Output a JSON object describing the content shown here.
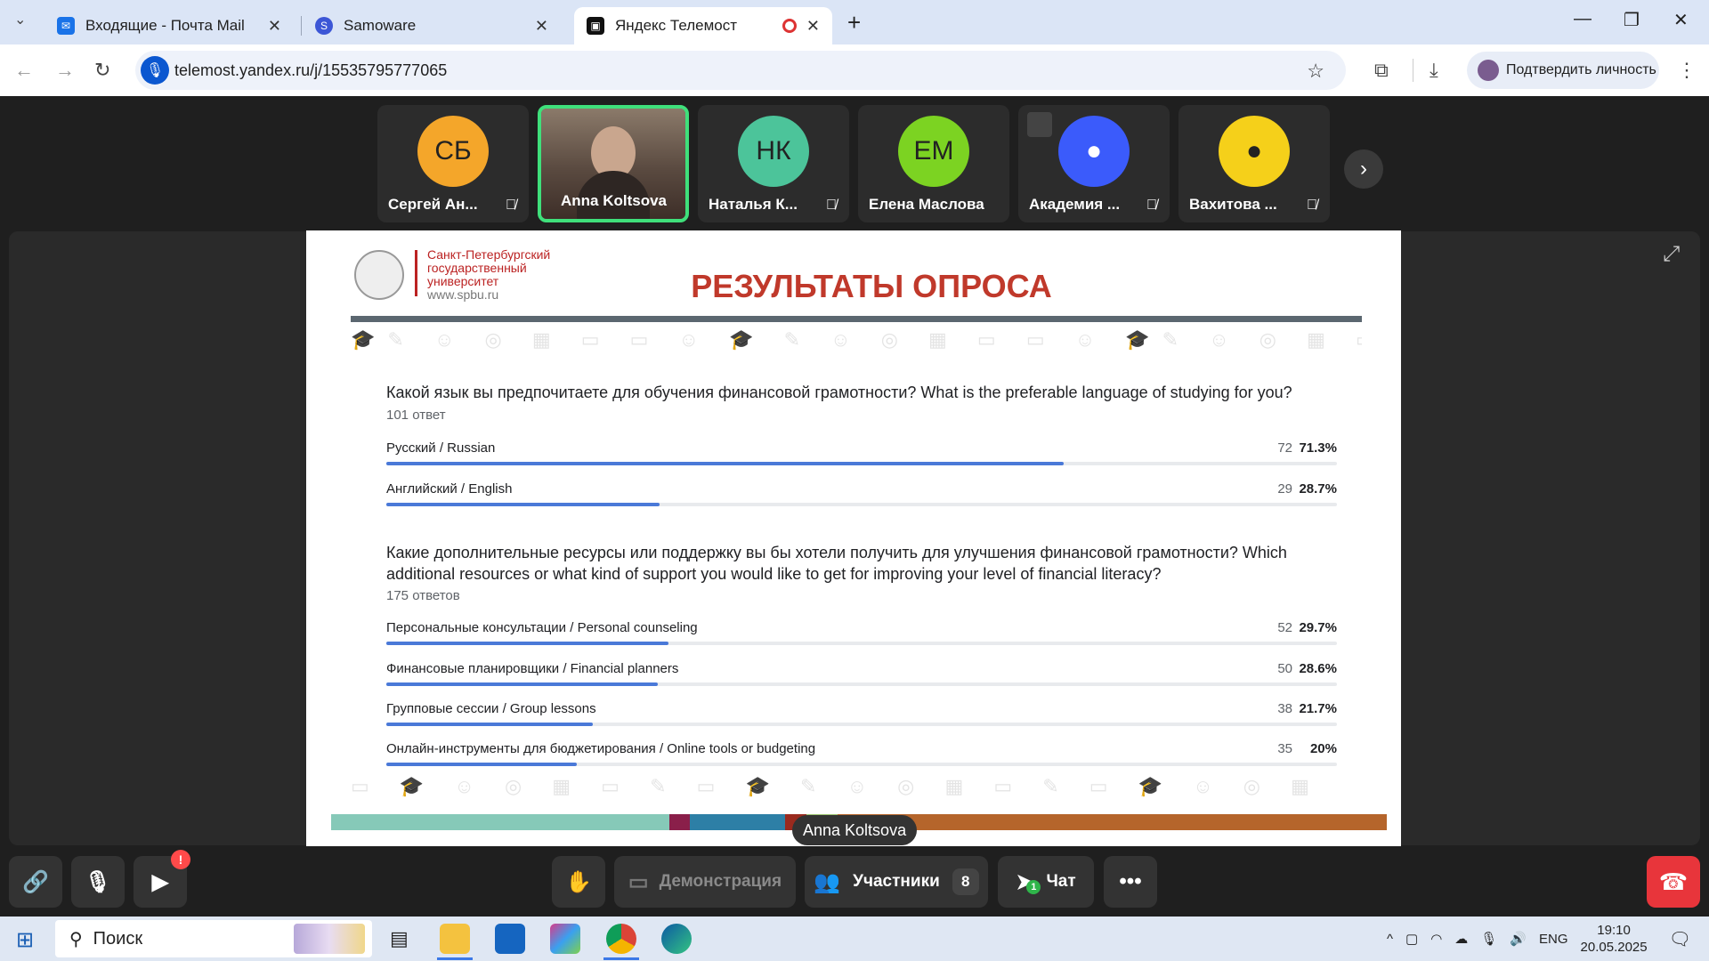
{
  "browser": {
    "tabs": [
      {
        "title": "Входящие - Почта Mail",
        "icon": "mail-icon"
      },
      {
        "title": "Samoware",
        "icon": "samoware-icon"
      },
      {
        "title": "Яндекс Телемост",
        "icon": "telemost-icon",
        "active": true
      }
    ],
    "url": "telemost.yandex.ru/j/15535795777065",
    "verify_label": "Подтвердить личность"
  },
  "participants": [
    {
      "initials": "СБ",
      "name": "Сергей Ан...",
      "color": "#f4a62a",
      "muted": true
    },
    {
      "initials": "",
      "name": "Anna Koltsova",
      "video": true,
      "speaking": true
    },
    {
      "initials": "НК",
      "name": "Наталья К...",
      "color": "#4cc49a",
      "muted": true
    },
    {
      "initials": "ЕМ",
      "name": "Елена Маслова",
      "color": "#7cd322",
      "muted": false
    },
    {
      "initials": "",
      "name": "Академия ...",
      "color": "#3b5bfb",
      "muted": true,
      "icon": "person-icon"
    },
    {
      "initials": "",
      "name": "Вахитова ...",
      "color": "#f5d01a",
      "muted": true,
      "icon": "person-icon"
    }
  ],
  "slide": {
    "university": [
      "Санкт-Петербургский",
      "государственный",
      "университет",
      "www.spbu.ru"
    ],
    "title": "РЕЗУЛЬТАТЫ ОПРОСА",
    "questions": [
      {
        "text": "Какой язык вы предпочитаете для обучения финансовой грамотности? What is the preferable language of studying for you?",
        "responses": "101 ответ",
        "options": [
          {
            "label": "Русский / Russian",
            "count": "72",
            "percent": "71.3%",
            "fraction": 0.713
          },
          {
            "label": "Английский / English",
            "count": "29",
            "percent": "28.7%",
            "fraction": 0.287
          }
        ]
      },
      {
        "text": "Какие дополнительные ресурсы или поддержку вы бы хотели получить для улучшения финансовой грамотности? Which additional resources or what kind of support you would like to get for improving your level of financial literacy?",
        "responses": "175 ответов",
        "options": [
          {
            "label": "Персональные консультации / Personal counseling",
            "count": "52",
            "percent": "29.7%",
            "fraction": 0.297
          },
          {
            "label": "Финансовые планировщики / Financial planners",
            "count": "50",
            "percent": "28.6%",
            "fraction": 0.286
          },
          {
            "label": "Групповые сессии / Group lessons",
            "count": "38",
            "percent": "21.7%",
            "fraction": 0.217
          },
          {
            "label": "Онлайн-инструменты для бюджетирования / Online tools or budgeting",
            "count": "35",
            "percent": "20%",
            "fraction": 0.2
          }
        ]
      }
    ],
    "color_bar": [
      "#86c9b8",
      "#8a1f4a",
      "#2d7fa6",
      "#9a2a1e",
      "#9bc46f",
      "#b5652b"
    ]
  },
  "speaker_tag": "Anna Koltsova",
  "controls": {
    "demo_label": "Демонстрация",
    "participants_label": "Участники",
    "participants_count": "8",
    "chat_label": "Чат",
    "chat_unread": "1",
    "alert_badge": "!"
  },
  "taskbar": {
    "search_placeholder": "Поиск",
    "language": "ENG",
    "time": "19:10",
    "date": "20.05.2025"
  }
}
